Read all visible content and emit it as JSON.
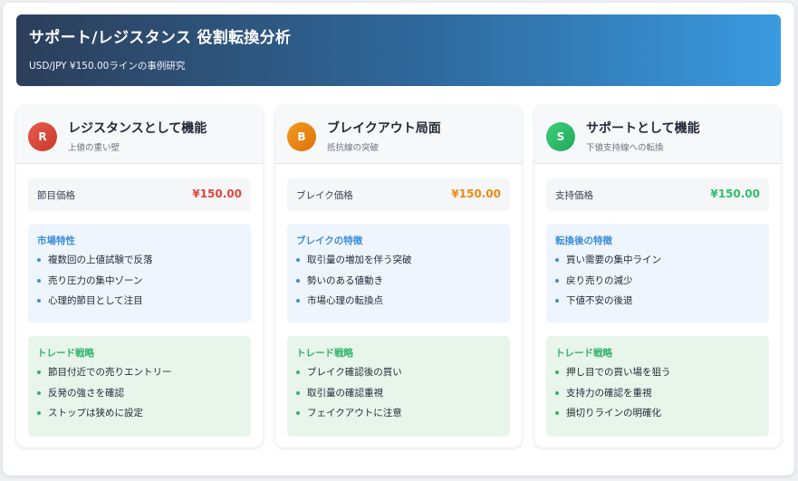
{
  "header": {
    "title": "サポート/レジスタンス 役割転換分析",
    "subtitle": "USD/JPY ¥150.00ラインの事例研究"
  },
  "colors": {
    "resistance": "#e0463a",
    "breakout": "#f08a12",
    "support": "#2fbf6a"
  },
  "cards": [
    {
      "badge": "R",
      "title": "レジスタンスとして機能",
      "subtitle": "上値の重い壁",
      "price_label": "節目価格",
      "price_value": "¥150.00",
      "market_title": "市場特性",
      "market_items": [
        "複数回の上値試験で反落",
        "売り圧力の集中ゾーン",
        "心理的節目として注目"
      ],
      "trade_title": "トレード戦略",
      "trade_items": [
        "節目付近での売りエントリー",
        "反発の強さを確認",
        "ストップは狭めに設定"
      ]
    },
    {
      "badge": "B",
      "title": "ブレイクアウト局面",
      "subtitle": "抵抗線の突破",
      "price_label": "ブレイク価格",
      "price_value": "¥150.00",
      "market_title": "ブレイクの特徴",
      "market_items": [
        "取引量の増加を伴う突破",
        "勢いのある値動き",
        "市場心理の転換点"
      ],
      "trade_title": "トレード戦略",
      "trade_items": [
        "ブレイク確認後の買い",
        "取引量の確認重視",
        "フェイクアウトに注意"
      ]
    },
    {
      "badge": "S",
      "title": "サポートとして機能",
      "subtitle": "下値支持線への転換",
      "price_label": "支持価格",
      "price_value": "¥150.00",
      "market_title": "転換後の特徴",
      "market_items": [
        "買い需要の集中ライン",
        "戻り売りの減少",
        "下値不安の後退"
      ],
      "trade_title": "トレード戦略",
      "trade_items": [
        "押し目での買い場を狙う",
        "支持力の確認を重視",
        "損切りラインの明確化"
      ]
    }
  ]
}
